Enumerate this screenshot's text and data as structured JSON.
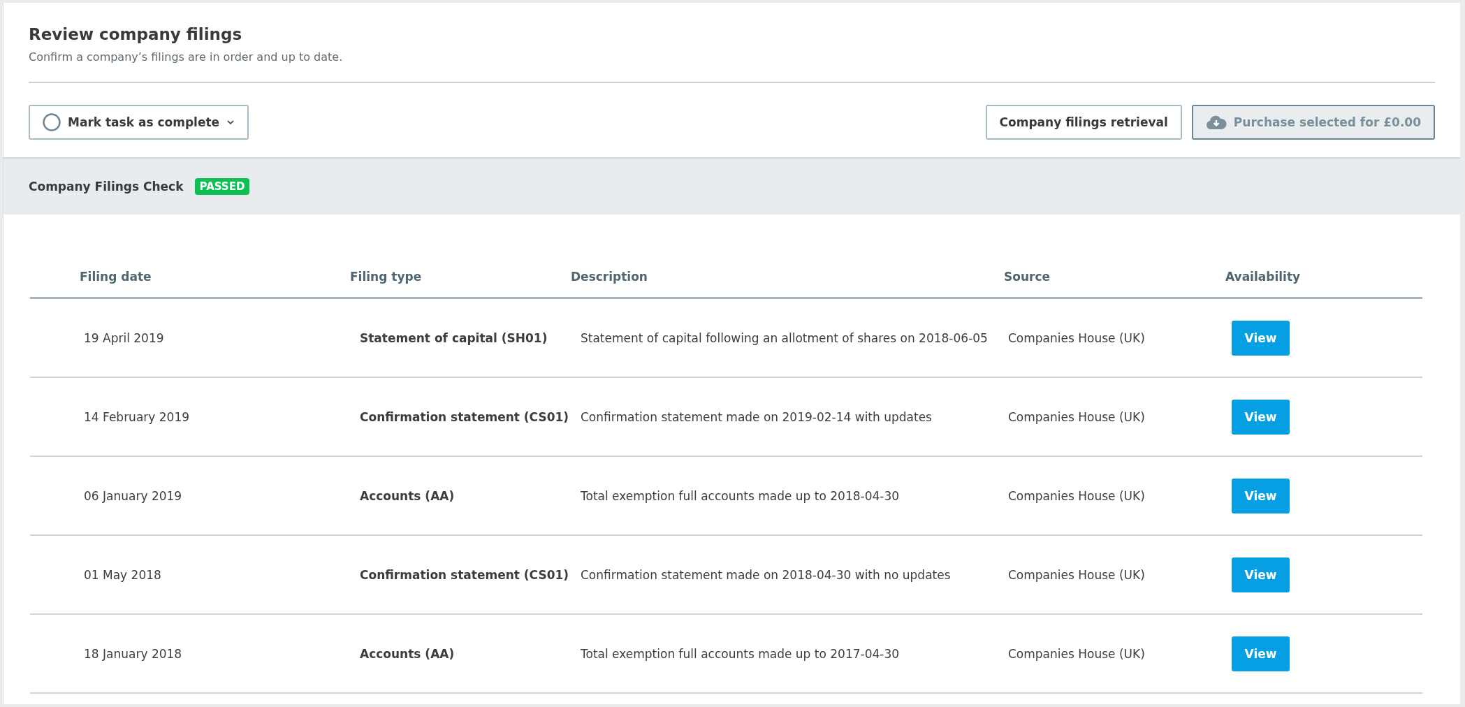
{
  "header": {
    "title": "Review company filings",
    "subtitle": "Confirm a company’s filings are in order and up to date."
  },
  "toolbar": {
    "mark_complete": {
      "label": "Mark task as complete",
      "checked": false
    },
    "retrieval_button": "Company filings retrieval",
    "purchase_button": {
      "label": "Purchase selected for £0.00",
      "disabled": true
    }
  },
  "check": {
    "title": "Company Filings Check",
    "status": "PASSED",
    "color": "#0cc152"
  },
  "table": {
    "columns": [
      "Filing date",
      "Filing type",
      "Description",
      "Source",
      "Availability"
    ],
    "rows": [
      {
        "date": "19 April 2019",
        "type": "Statement of capital (SH01)",
        "description": "Statement of capital following an allotment of shares on 2018-06-05",
        "source": "Companies House (UK)",
        "action": "View"
      },
      {
        "date": "14 February 2019",
        "type": "Confirmation statement (CS01)",
        "description": "Confirmation statement made on 2019-02-14 with updates",
        "source": "Companies House (UK)",
        "action": "View"
      },
      {
        "date": "06 January 2019",
        "type": "Accounts (AA)",
        "description": "Total exemption full accounts made up to 2018-04-30",
        "source": "Companies House (UK)",
        "action": "View"
      },
      {
        "date": "01 May 2018",
        "type": "Confirmation statement (CS01)",
        "description": "Confirmation statement made on 2018-04-30 with no updates",
        "source": "Companies House (UK)",
        "action": "View"
      },
      {
        "date": "18 January 2018",
        "type": "Accounts (AA)",
        "description": "Total exemption full accounts made up to 2017-04-30",
        "source": "Companies House (UK)",
        "action": "View"
      }
    ]
  }
}
